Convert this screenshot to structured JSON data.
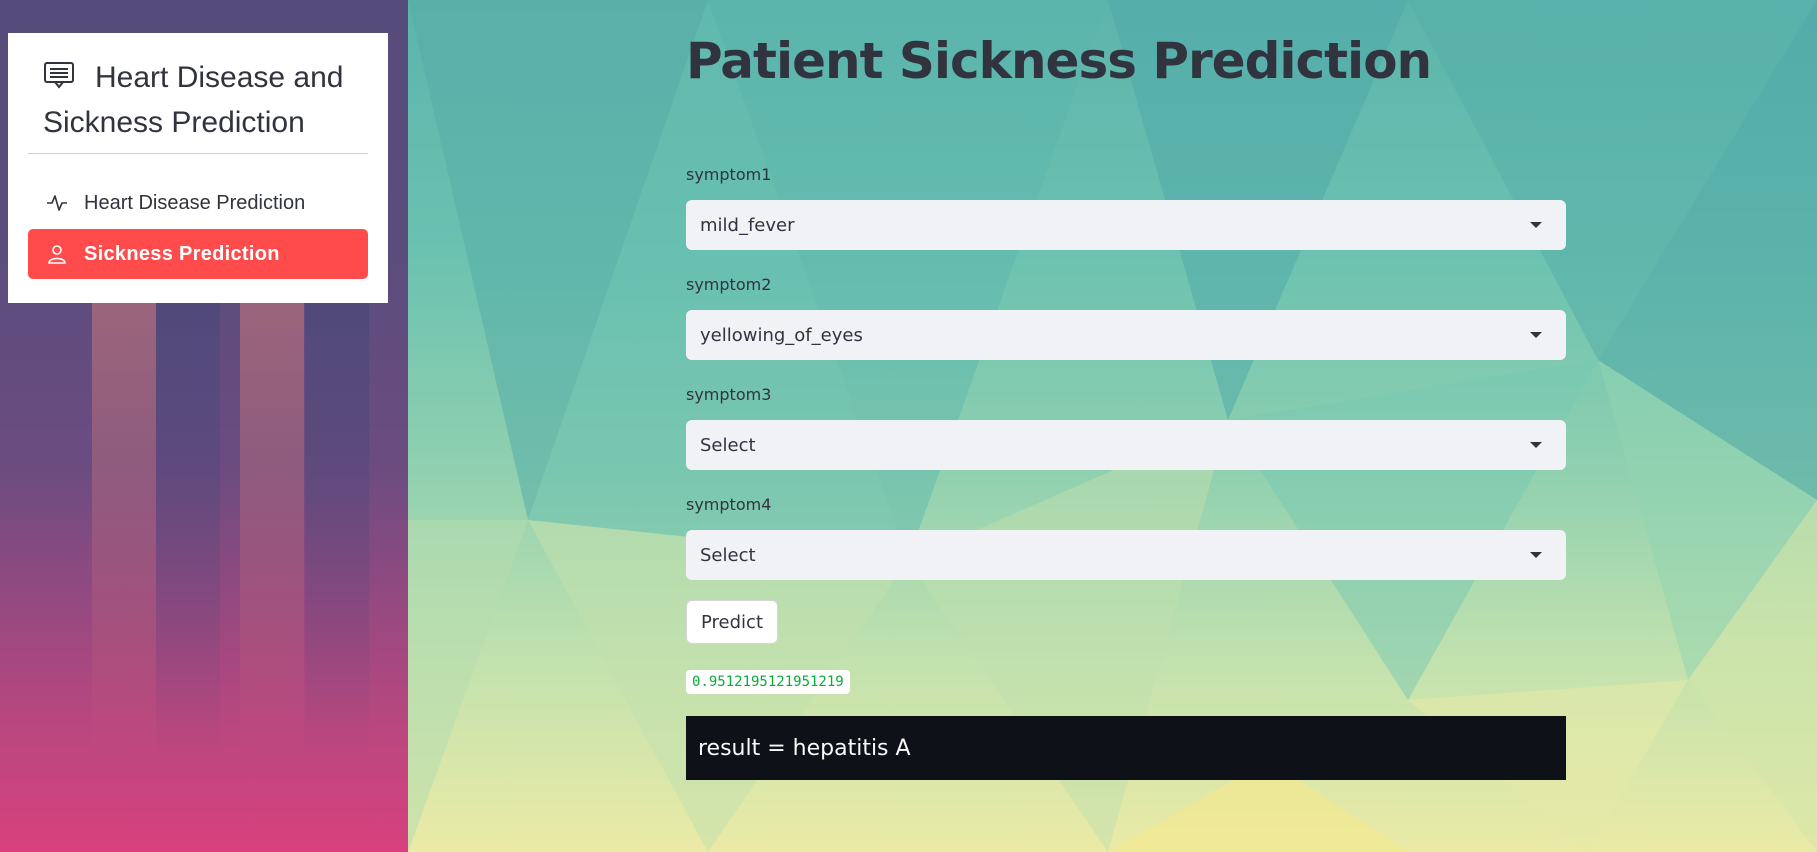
{
  "sidebar": {
    "title": "Heart Disease and Sickness Prediction",
    "items": [
      {
        "label": "Heart Disease Prediction",
        "icon": "activity-icon",
        "active": false
      },
      {
        "label": "Sickness Prediction",
        "icon": "person-icon",
        "active": true
      }
    ],
    "colors": {
      "active_bg": "#ff4b4b",
      "card_bg": "#ffffff"
    }
  },
  "main": {
    "title": "Patient Sickness Prediction",
    "fields": [
      {
        "label": "symptom1",
        "value": "mild_fever"
      },
      {
        "label": "symptom2",
        "value": "yellowing_of_eyes"
      },
      {
        "label": "symptom3",
        "value": "Select"
      },
      {
        "label": "symptom4",
        "value": "Select"
      }
    ],
    "predict_label": "Predict",
    "score": "0.9512195121951219",
    "result": "result = hepatitis A",
    "colors": {
      "select_bg": "#f0f2f6",
      "result_bg": "#0e1117",
      "score_text": "#09ab3b"
    }
  }
}
